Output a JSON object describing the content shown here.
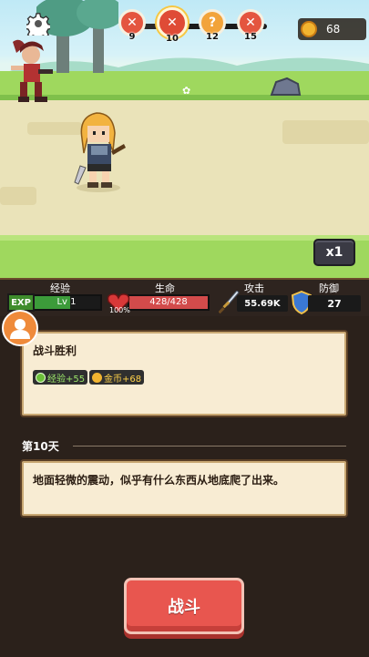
{
  "hud": {
    "stages": [
      {
        "number": "9",
        "glyph": "✕",
        "state": "cleared"
      },
      {
        "number": "10",
        "glyph": "✕",
        "state": "current"
      },
      {
        "number": "12",
        "glyph": "?",
        "state": "boss"
      },
      {
        "number": "15",
        "glyph": "✕",
        "state": "cleared"
      }
    ],
    "coins": "68",
    "speed": "x1"
  },
  "stats": {
    "exp": {
      "label": "经验",
      "badge": "EXP",
      "level": "Lv 1",
      "progress": 0.55
    },
    "hp": {
      "label": "生命",
      "value": "428/428",
      "percent": "100%",
      "progress": 1.0
    },
    "attack": {
      "label": "攻击",
      "value": "55.69K"
    },
    "defense": {
      "label": "防御",
      "value": "27"
    }
  },
  "log": {
    "battle_title": "战斗胜利",
    "rewards": {
      "exp": "经验+55",
      "gold": "金币+68"
    },
    "day_header": "第10天",
    "event_text": "地面轻微的震动，似乎有什么东西从地底爬了出来。"
  },
  "actions": {
    "fight": "战斗"
  },
  "colors": {
    "accent_red": "#e8564f",
    "exp_green": "#3c9b3a",
    "hp_red": "#d24b4b",
    "gold": "#f2b430"
  }
}
